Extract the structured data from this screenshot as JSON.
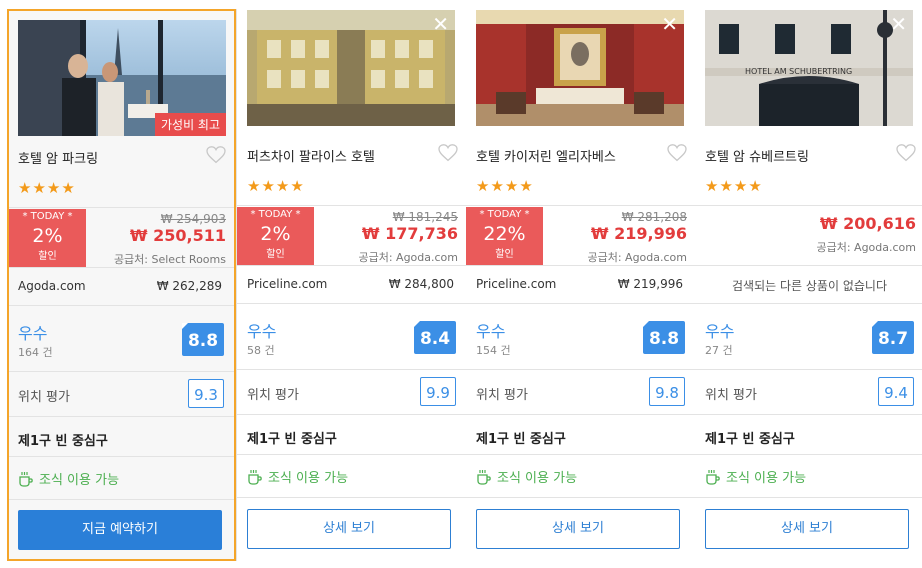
{
  "hotels": [
    {
      "name": "호텔 암 파크링",
      "badge": "가성비 최고",
      "stars": "★★★★",
      "deal": {
        "label": "* TODAY *",
        "percent": "2%",
        "sub": "할인"
      },
      "original_price": "₩ 254,903",
      "price": "₩ 250,511",
      "supplier": "공급처: Select Rooms",
      "provider": {
        "name": "Agoda.com",
        "price": "₩ 262,289"
      },
      "rating": {
        "label": "우수",
        "count": "164 건",
        "score": "8.8"
      },
      "location": {
        "label": "위치 평가",
        "score": "9.3"
      },
      "district": "제1구 빈 중심구",
      "breakfast": "조식 이용 가능",
      "button": "지금 예약하기"
    },
    {
      "name": "퍼츠차이 팔라이스 호텔",
      "close": "✕",
      "stars": "★★★★",
      "deal": {
        "label": "* TODAY *",
        "percent": "2%",
        "sub": "할인"
      },
      "original_price": "₩ 181,245",
      "price": "₩ 177,736",
      "supplier": "공급처: Agoda.com",
      "provider": {
        "name": "Priceline.com",
        "price": "₩ 284,800"
      },
      "rating": {
        "label": "우수",
        "count": "58 건",
        "score": "8.4"
      },
      "location": {
        "label": "위치 평가",
        "score": "9.9"
      },
      "district": "제1구 빈 중심구",
      "breakfast": "조식 이용 가능",
      "button": "상세 보기"
    },
    {
      "name": "호텔 카이저린 엘리자베스",
      "close": "✕",
      "stars": "★★★★",
      "deal": {
        "label": "* TODAY *",
        "percent": "22%",
        "sub": "할인"
      },
      "original_price": "₩ 281,208",
      "price": "₩ 219,996",
      "supplier": "공급처: Agoda.com",
      "provider": {
        "name": "Priceline.com",
        "price": "₩ 219,996"
      },
      "rating": {
        "label": "우수",
        "count": "154 건",
        "score": "8.8"
      },
      "location": {
        "label": "위치 평가",
        "score": "9.8"
      },
      "district": "제1구 빈 중심구",
      "breakfast": "조식 이용 가능",
      "button": "상세 보기"
    },
    {
      "name": "호텔 암 슈베르트링",
      "close": "✕",
      "stars": "★★★★",
      "price": "₩ 200,616",
      "supplier": "공급처: Agoda.com",
      "no_result": "검색되는 다른 상품이 없습니다",
      "rating": {
        "label": "우수",
        "count": "27 건",
        "score": "8.7"
      },
      "location": {
        "label": "위치 평가",
        "score": "9.4"
      },
      "district": "제1구 빈 중심구",
      "breakfast": "조식 이용 가능",
      "button": "상세 보기",
      "photo_sign": "HOTEL AM SCHUBERTRING"
    }
  ],
  "colors": {
    "accent": "#2a7fd8",
    "deal_red": "#ea5a5a",
    "price_red": "#e23c3c",
    "star": "#f39a1a",
    "rating_blue": "#3b8fe6",
    "breakfast_green": "#4caf50",
    "highlight_border": "#f4a52a"
  }
}
